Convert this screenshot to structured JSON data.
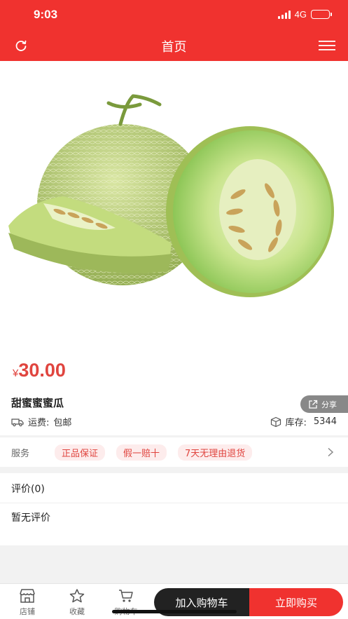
{
  "status": {
    "time": "9:03",
    "network": "4G"
  },
  "nav": {
    "title": "首页"
  },
  "product": {
    "price_symbol": "¥",
    "price": "30.00",
    "title": "甜蜜蜜蜜瓜",
    "share_label": "分享",
    "shipping_label": "运费:",
    "shipping_value": "包邮",
    "stock_label": "库存:",
    "stock_value": "5344"
  },
  "service": {
    "label": "服务",
    "tags": [
      "正品保证",
      "假一赔十",
      "7天无理由退货"
    ]
  },
  "reviews": {
    "header": "评价(0)",
    "empty": "暂无评价"
  },
  "bottom_bar": {
    "shop": "店铺",
    "favorite": "收藏",
    "cart": "购物车",
    "add_to_cart": "加入购物车",
    "buy_now": "立即购买"
  },
  "colors": {
    "brand": "#f0322f",
    "price": "#e0453f"
  }
}
